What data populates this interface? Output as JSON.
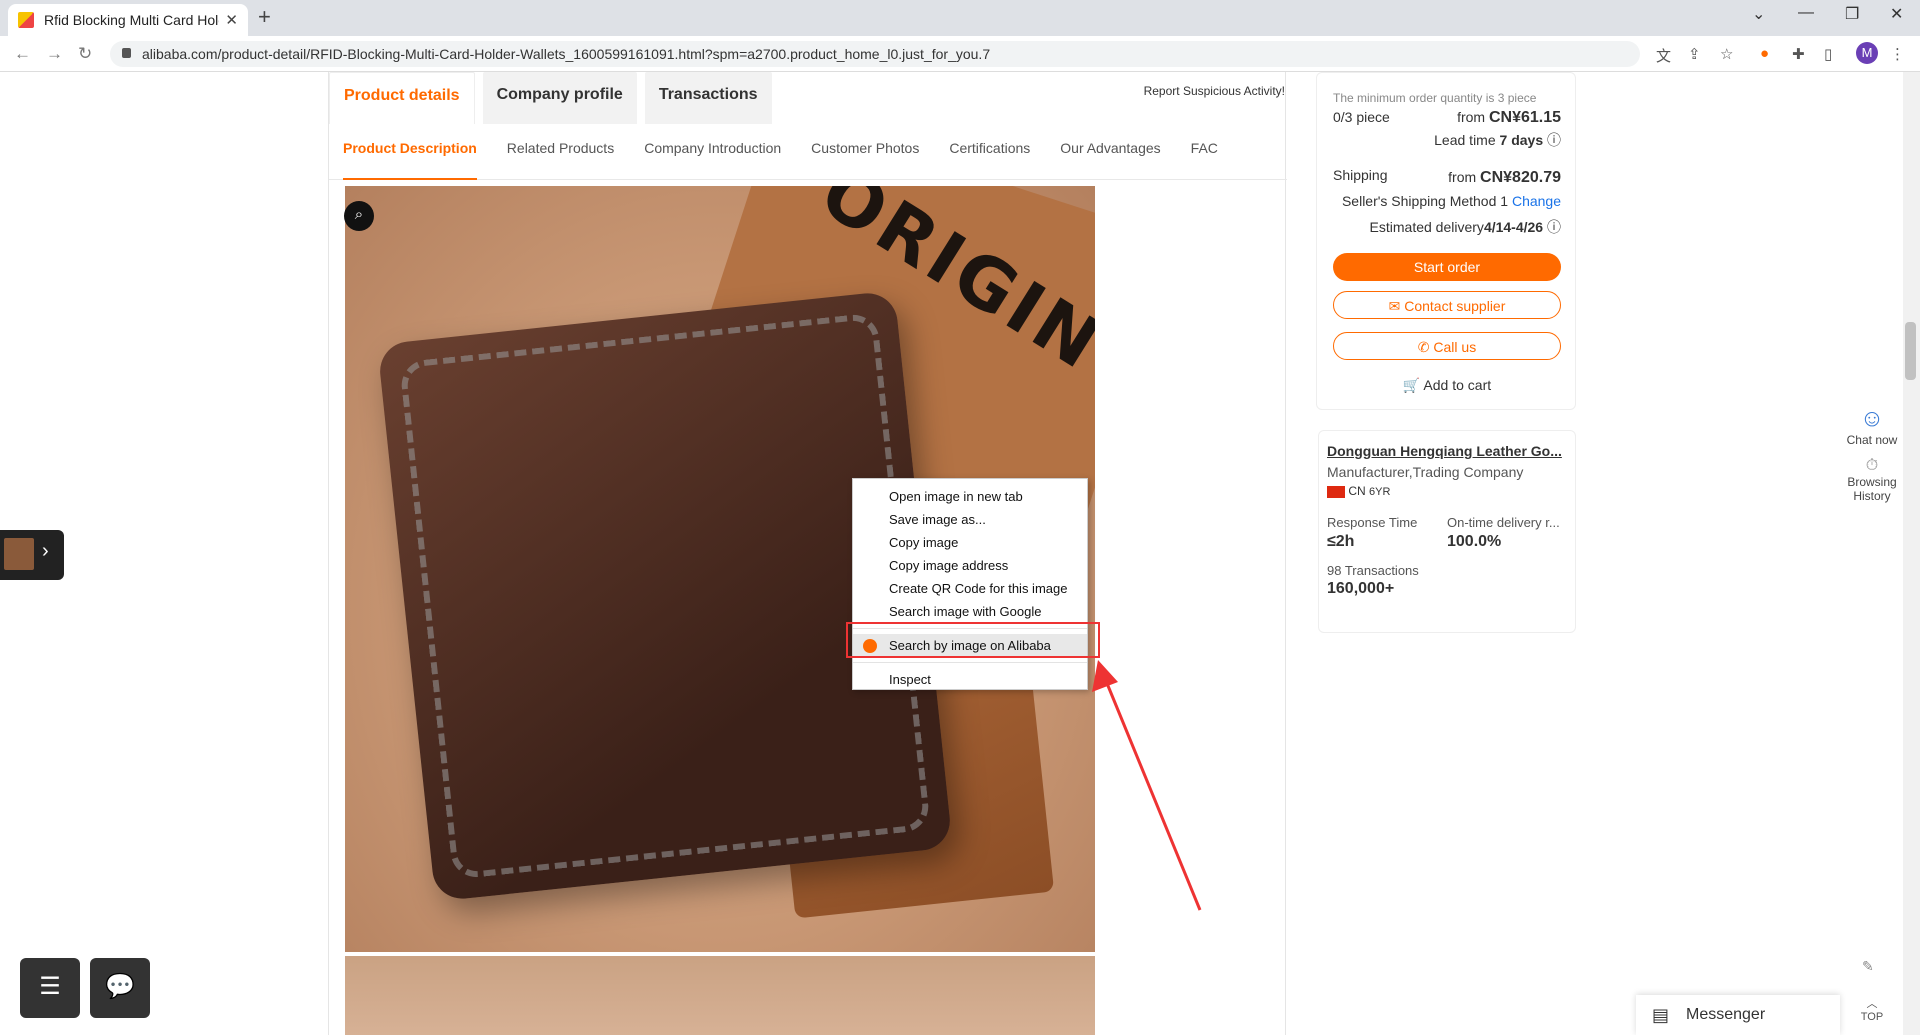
{
  "browser": {
    "tab_title": "Rfid Blocking Multi Card Holde",
    "url": "alibaba.com/product-detail/RFID-Blocking-Multi-Card-Holder-Wallets_1600599161091.html?spm=a2700.product_home_l0.just_for_you.7",
    "profile_letter": "M"
  },
  "page_tabs": [
    "Product details",
    "Company profile",
    "Transactions"
  ],
  "report": "Report Suspicious Activity!",
  "sub_tabs": [
    "Product Description",
    "Related Products",
    "Company Introduction",
    "Customer Photos",
    "Certifications",
    "Our Advantages",
    "FAC"
  ],
  "product_image_text": "ORIGIN",
  "order": {
    "min_qty": "The minimum order quantity is 3 piece",
    "qty": "0/3 piece",
    "price_prefix": "from",
    "price": "CN¥61.15",
    "lead_label": "Lead time",
    "lead_value": "7 days",
    "shipping_label": "Shipping",
    "shipping_prefix": "from",
    "shipping_price": "CN¥820.79",
    "method": "Seller's Shipping Method 1",
    "change": "Change",
    "delivery_label": "Estimated delivery",
    "delivery_value": "4/14-4/26",
    "start_order": "Start order",
    "contact": "Contact supplier",
    "call": "Call us",
    "cart": "Add to cart"
  },
  "supplier": {
    "name": "Dongguan Hengqiang Leather Go...",
    "type": "Manufacturer,Trading Company",
    "country": "CN",
    "years": "6YR",
    "response_label": "Response Time",
    "response_value": "≤2h",
    "ontime_label": "On-time delivery r...",
    "ontime_value": "100.0%",
    "transactions_label": "98 Transactions",
    "transactions_value": "160,000+"
  },
  "side_rail": {
    "chat": "Chat now",
    "history": "Browsing History",
    "top": "TOP"
  },
  "messenger": "Messenger",
  "context_menu": [
    "Open image in new tab",
    "Save image as...",
    "Copy image",
    "Copy image address",
    "Create QR Code for this image",
    "Search image with Google",
    "Search by image on Alibaba",
    "Inspect"
  ]
}
